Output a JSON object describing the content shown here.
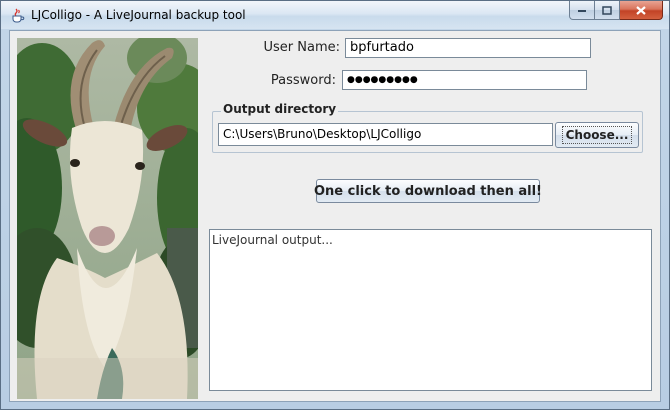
{
  "window": {
    "title": "LJColligo - A LiveJournal backup tool",
    "icons": {
      "app": "java-coffee-cup-icon",
      "minimize": "minimize-icon",
      "maximize": "maximize-icon",
      "close": "close-icon"
    }
  },
  "form": {
    "username_label": "User Name:",
    "username_value": "bpfurtado",
    "password_label": "Password:",
    "password_value": "●●●●●●●●●"
  },
  "output_directory": {
    "group_title": "Output directory",
    "path_value": "C:\\Users\\Bruno\\Desktop\\LJColligo",
    "choose_label": "Choose..."
  },
  "actions": {
    "download_label": "One click to download then all!"
  },
  "output": {
    "text": "LiveJournal output..."
  },
  "image": {
    "subject": "white goat with long curved horns, painted style"
  },
  "colors": {
    "close_button": "#c24326",
    "titlebar": "#dbe7f3",
    "client_bg": "#eeeeee"
  }
}
